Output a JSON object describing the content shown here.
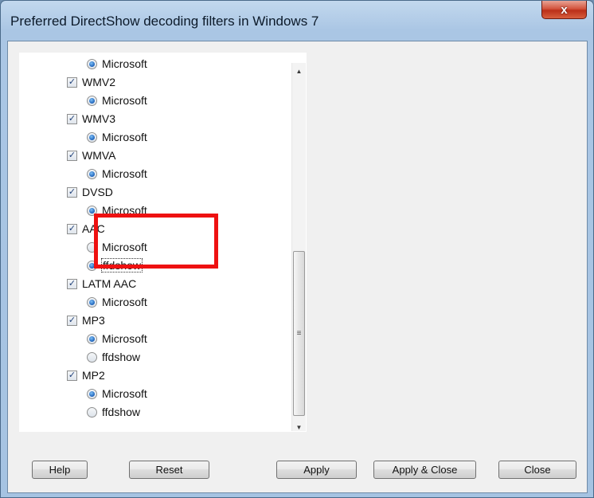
{
  "window": {
    "title": "Preferred DirectShow decoding filters in Windows 7",
    "close_glyph": "x"
  },
  "tree": {
    "items": [
      {
        "kind": "radio",
        "label": "Microsoft",
        "checked": true
      },
      {
        "kind": "check",
        "label": "WMV2",
        "checked": true
      },
      {
        "kind": "radio",
        "label": "Microsoft",
        "checked": true
      },
      {
        "kind": "check",
        "label": "WMV3",
        "checked": true
      },
      {
        "kind": "radio",
        "label": "Microsoft",
        "checked": true
      },
      {
        "kind": "check",
        "label": "WMVA",
        "checked": true
      },
      {
        "kind": "radio",
        "label": "Microsoft",
        "checked": true
      },
      {
        "kind": "check",
        "label": "DVSD",
        "checked": true
      },
      {
        "kind": "radio",
        "label": "Microsoft",
        "checked": true
      },
      {
        "kind": "check",
        "label": "AAC",
        "checked": true
      },
      {
        "kind": "radio",
        "label": "Microsoft",
        "checked": false
      },
      {
        "kind": "radio",
        "label": "ffdshow",
        "checked": true,
        "focused": true
      },
      {
        "kind": "check",
        "label": "LATM AAC",
        "checked": true
      },
      {
        "kind": "radio",
        "label": "Microsoft",
        "checked": true
      },
      {
        "kind": "check",
        "label": "MP3",
        "checked": true
      },
      {
        "kind": "radio",
        "label": "Microsoft",
        "checked": true
      },
      {
        "kind": "radio",
        "label": "ffdshow",
        "checked": false
      },
      {
        "kind": "check",
        "label": "MP2",
        "checked": true
      },
      {
        "kind": "radio",
        "label": "Microsoft",
        "checked": true
      },
      {
        "kind": "radio",
        "label": "ffdshow",
        "checked": false
      }
    ]
  },
  "scrollbar": {
    "up_glyph": "▲",
    "down_glyph": "▼",
    "grip_glyph": "≡"
  },
  "buttons": {
    "help": "Help",
    "reset": "Reset",
    "apply": "Apply",
    "apply_close": "Apply & Close",
    "close": "Close"
  },
  "colors": {
    "highlight": "#ee1111",
    "radio_selected": "#2a6fc4"
  }
}
